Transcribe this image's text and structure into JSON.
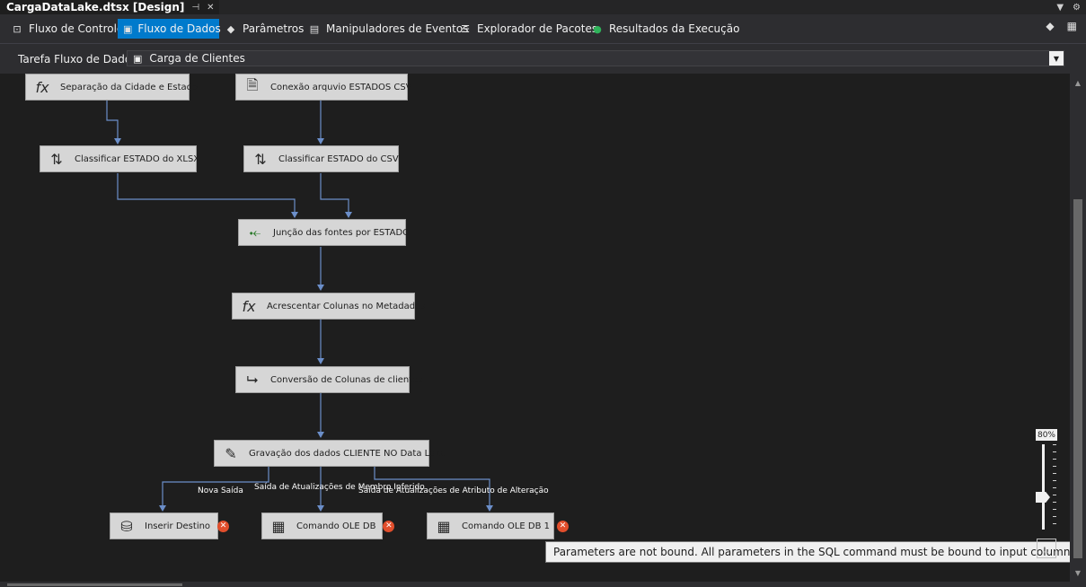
{
  "document_tab": {
    "title": "CargaDataLake.dtsx [Design]",
    "pin_icon": "pin-icon",
    "close_icon": "close-icon"
  },
  "tabs": [
    {
      "label": "Fluxo de Controle",
      "icon": "control-flow-icon",
      "active": false
    },
    {
      "label": "Fluxo de Dados",
      "icon": "data-flow-icon",
      "active": true
    },
    {
      "label": "Parâmetros",
      "icon": "parameters-icon",
      "active": false
    },
    {
      "label": "Manipuladores de Eventos",
      "icon": "event-handlers-icon",
      "active": false
    },
    {
      "label": "Explorador de Pacotes",
      "icon": "package-explorer-icon",
      "active": false
    },
    {
      "label": "Resultados da Execução",
      "icon": "play-icon",
      "active": false
    }
  ],
  "task": {
    "label": "Tarefa Fluxo de Dados:",
    "selected": "Carga de Clientes"
  },
  "components": {
    "separacao": {
      "label": "Separação da Cidade e Estado",
      "icon": "derived-column-icon"
    },
    "conexao_csv": {
      "label": "Conexão arquvio ESTADOS CSV",
      "icon": "flat-file-source-icon"
    },
    "sort_xlsx": {
      "label": "Classificar ESTADO do XLSX",
      "icon": "sort-icon"
    },
    "sort_csv": {
      "label": "Classificar ESTADO do CSV",
      "icon": "sort-icon"
    },
    "juncao": {
      "label": "Junção das fontes por ESTADO",
      "icon": "merge-join-icon"
    },
    "acrescentar": {
      "label": "Acrescentar Colunas no Metadados",
      "icon": "derived-column-icon"
    },
    "conversao": {
      "label": "Conversão de Colunas de clientes",
      "icon": "data-conversion-icon"
    },
    "gravacao": {
      "label": "Gravação dos dados CLIENTE NO Data Lake",
      "icon": "scd-icon"
    },
    "inserir": {
      "label": "Inserir Destino",
      "icon": "ole-db-destination-icon",
      "error": true
    },
    "comando1": {
      "label": "Comando OLE DB",
      "icon": "ole-db-command-icon",
      "error": true
    },
    "comando2": {
      "label": "Comando OLE DB 1",
      "icon": "ole-db-command-icon",
      "error": true
    }
  },
  "path_labels": {
    "nova_saida": "Nova Saída",
    "membro_inferido": "Saída de Atualizações de Membro Inferido",
    "atributo_alteracao": "Saída de Atualizações de Atributo de Alteração"
  },
  "tooltip": "Parameters are not bound. All parameters in the SQL command must be bound to input columns.",
  "zoom": {
    "label": "80%",
    "value": 0.8
  }
}
